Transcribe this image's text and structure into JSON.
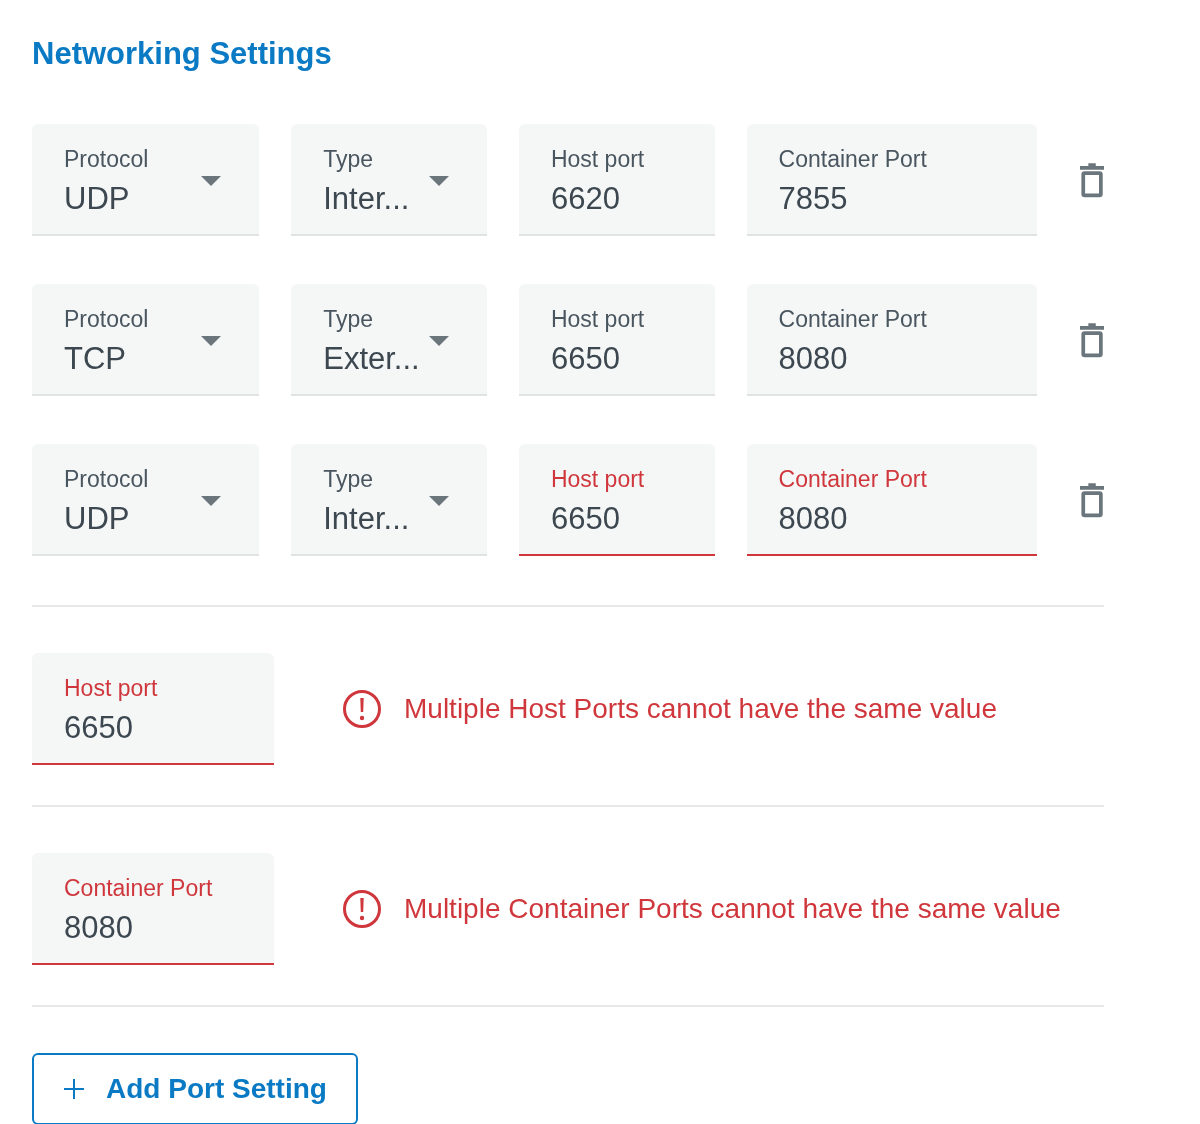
{
  "title": "Networking Settings",
  "rows": [
    {
      "fields": [
        {
          "kind": "select",
          "label": "Protocol",
          "value": "UDP",
          "error": false
        },
        {
          "kind": "select",
          "label": "Type",
          "value": "Inter...",
          "error": false
        },
        {
          "kind": "text",
          "label": "Host port",
          "value": "6620",
          "error": false
        },
        {
          "kind": "text",
          "label": "Container Port",
          "value": "7855",
          "error": false
        }
      ]
    },
    {
      "fields": [
        {
          "kind": "select",
          "label": "Protocol",
          "value": "TCP",
          "error": false
        },
        {
          "kind": "select",
          "label": "Type",
          "value": "Exter...",
          "error": false
        },
        {
          "kind": "text",
          "label": "Host port",
          "value": "6650",
          "error": false
        },
        {
          "kind": "text",
          "label": "Container Port",
          "value": "8080",
          "error": false
        }
      ]
    },
    {
      "fields": [
        {
          "kind": "select",
          "label": "Protocol",
          "value": "UDP",
          "error": false
        },
        {
          "kind": "select",
          "label": "Type",
          "value": "Inter...",
          "error": false
        },
        {
          "kind": "text",
          "label": "Host port",
          "value": "6650",
          "error": true
        },
        {
          "kind": "text",
          "label": "Container Port",
          "value": "8080",
          "error": true
        }
      ]
    }
  ],
  "errors": [
    {
      "field": {
        "label": "Host port",
        "value": "6650",
        "error": true
      },
      "message": "Multiple Host Ports cannot have the same value"
    },
    {
      "field": {
        "label": "Container Port",
        "value": "8080",
        "error": true
      },
      "message": "Multiple Container Ports cannot have the same value"
    }
  ],
  "add_button": "Add Port Setting"
}
